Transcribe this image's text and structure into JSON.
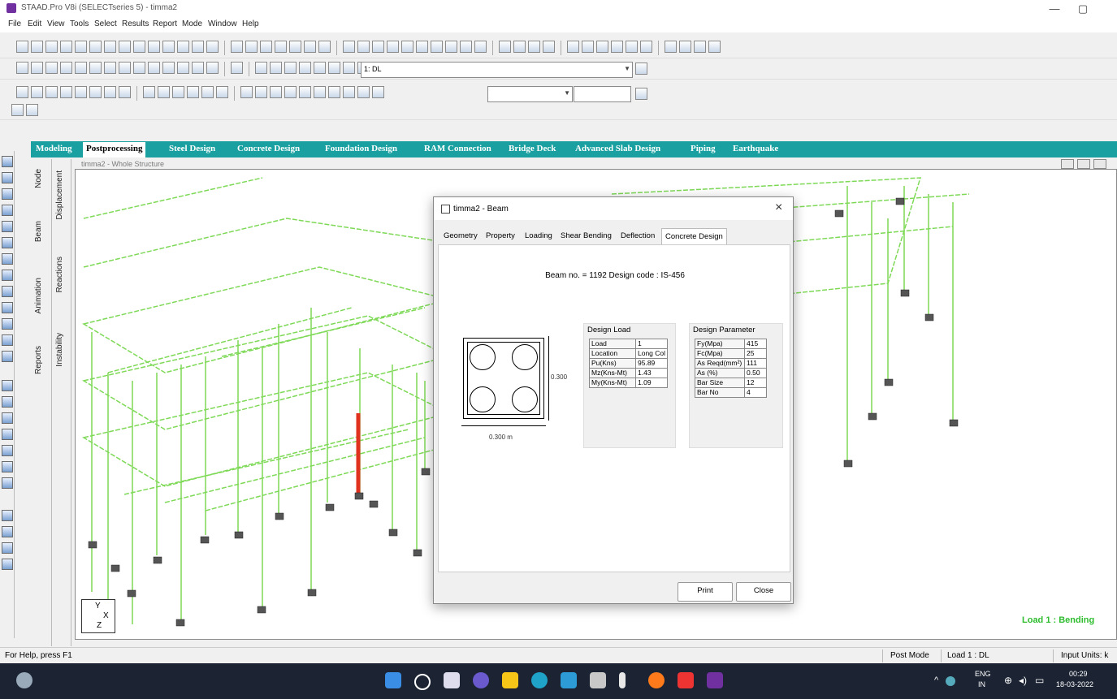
{
  "window": {
    "title": "STAAD.Pro V8i (SELECTseries 5) - timma2",
    "minimize": "—",
    "restore": "▢",
    "close": "✕"
  },
  "menu": [
    "File",
    "Edit",
    "View",
    "Tools",
    "Select",
    "Results",
    "Report",
    "Mode",
    "Window",
    "Help"
  ],
  "toolbar": {
    "load_combo": "1: DL"
  },
  "page_tabs": [
    "Modeling",
    "Postprocessing",
    "Steel Design",
    "Concrete Design",
    "Foundation Design",
    "RAM Connection",
    "Bridge Deck",
    "Advanced Slab Design",
    "Piping",
    "Earthquake"
  ],
  "side_tabs": {
    "strip2": [
      "Node",
      "Beam",
      "Animation",
      "Reports"
    ],
    "strip3": [
      "Displacement",
      "Reactions",
      "Instability"
    ]
  },
  "viewport": {
    "title": "timma2 - Whole Structure",
    "load_label": "Load 1 : Bending",
    "axis": {
      "y": "Y",
      "x": "X",
      "z": "Z"
    }
  },
  "dialog": {
    "title": "timma2 - Beam",
    "close": "×",
    "tabs": [
      "Geometry",
      "Property",
      "Loading",
      "Shear Bending",
      "Deflection",
      "Concrete Design"
    ],
    "active_tab": "Concrete Design",
    "beam_info": "Beam no. = 1192  Design code :  IS-456",
    "section": {
      "width_label": "0.300 m",
      "depth_label": "0.300"
    },
    "design_load": {
      "title": "Design Load",
      "rows": [
        [
          "Load",
          "1"
        ],
        [
          "Location",
          "Long Col"
        ],
        [
          "Pu(Kns)",
          "95.89"
        ],
        [
          "Mz(Kns-Mt)",
          "1.43"
        ],
        [
          "My(Kns-Mt)",
          "1.09"
        ]
      ]
    },
    "design_parameter": {
      "title": "Design Parameter",
      "rows": [
        [
          "Fy(Mpa)",
          "415"
        ],
        [
          "Fc(Mpa)",
          "25"
        ],
        [
          "As Reqd(mm²)",
          "111"
        ],
        [
          "As (%)",
          "0.50"
        ],
        [
          "Bar Size",
          "12"
        ],
        [
          "Bar No",
          "4"
        ]
      ]
    },
    "buttons": {
      "print": "Print",
      "close": "Close"
    }
  },
  "statusbar": {
    "help": "For Help, press F1",
    "mode": "Post Mode",
    "load": "Load 1 : DL",
    "units": "Input Units: k"
  },
  "taskbar": {
    "lang_top": "ENG",
    "lang_bottom": "IN",
    "time": "00:29",
    "date": "18-03-2022"
  }
}
